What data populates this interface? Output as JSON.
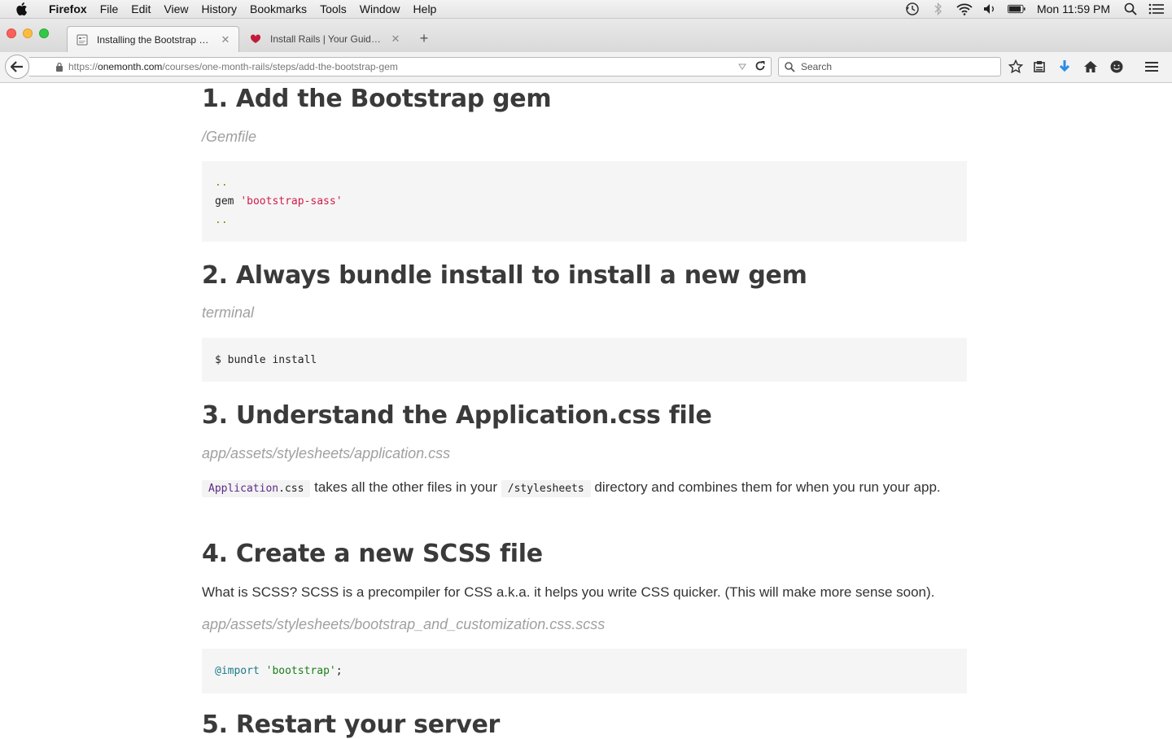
{
  "menubar": {
    "app_name": "Firefox",
    "items": [
      "File",
      "Edit",
      "View",
      "History",
      "Bookmarks",
      "Tools",
      "Window",
      "Help"
    ],
    "clock": "Mon 11:59 PM",
    "status_icons": [
      "time-machine-icon",
      "bluetooth-icon",
      "wifi-icon",
      "volume-icon",
      "battery-icon",
      "spotlight-icon",
      "notification-center-icon"
    ]
  },
  "tabs": [
    {
      "title": "Installing the Bootstrap Ge...",
      "active": true,
      "favicon": "page-icon"
    },
    {
      "title": "Install Rails | Your Guide for...",
      "active": false,
      "favicon": "rails-icon"
    }
  ],
  "navbar": {
    "url_prefix": "https://",
    "url_domain": "onemonth.com",
    "url_path": "/courses/one-month-rails/steps/add-the-bootstrap-gem",
    "search_placeholder": "Search"
  },
  "content": {
    "s1": {
      "heading": "1. Add the Bootstrap gem",
      "path": "/Gemfile",
      "code_dots_top": "..",
      "code_gem": "gem ",
      "code_gem_str": "'bootstrap-sass'",
      "code_dots_bottom": ".."
    },
    "s2": {
      "heading": "2. Always bundle install to install a new gem",
      "path": "terminal",
      "code": "$ bundle install"
    },
    "s3": {
      "heading": "3. Understand the Application.css file",
      "path": "app/assets/stylesheets/application.css",
      "inline1_kw": "Application",
      "inline1_rest": ".css",
      "text1": " takes all the other files in your ",
      "inline2": "/stylesheets",
      "text2": " directory and combines them for when you run your app."
    },
    "s4": {
      "heading": "4. Create a new SCSS file",
      "para": "What is SCSS? SCSS is a precompiler for CSS a.k.a. it helps you write CSS quicker. (This will make more sense soon).",
      "path": "app/assets/stylesheets/bootstrap_and_customization.css.scss",
      "code_kw": "@import",
      "code_str": "'bootstrap'",
      "code_end": ";"
    },
    "s5": {
      "heading": "5. Restart your server"
    }
  }
}
